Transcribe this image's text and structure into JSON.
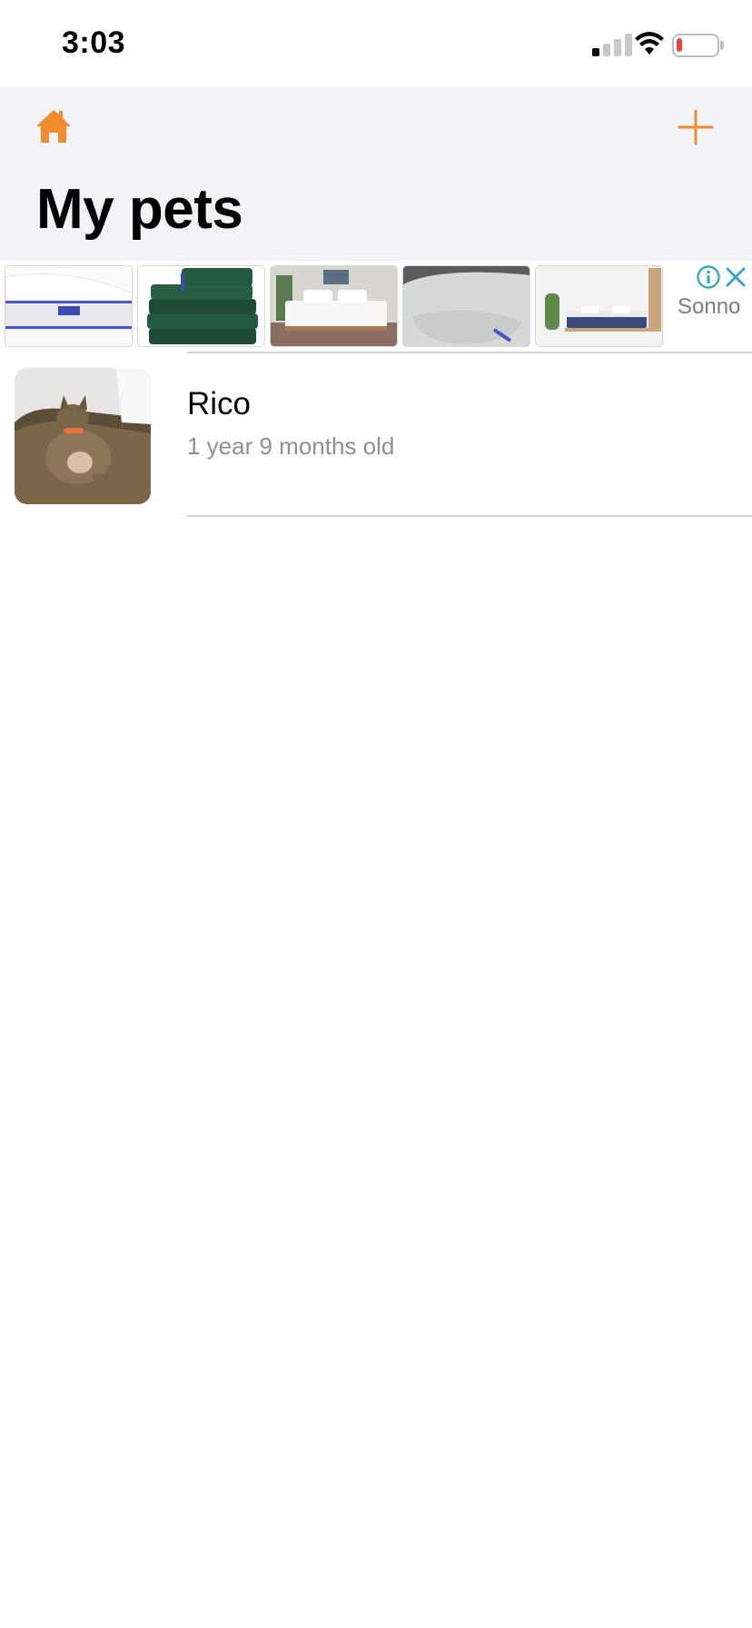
{
  "status_bar": {
    "time": "3:03",
    "signal_icon": "cellular-signal-icon",
    "wifi_icon": "wifi-icon",
    "battery_icon": "battery-low-icon",
    "battery_level": 0.15
  },
  "header": {
    "home_icon": "home-icon",
    "add_icon": "plus-icon",
    "title": "My pets",
    "accent_color": "#f28b30"
  },
  "ad": {
    "brand": "Sonno",
    "info_icon": "info-icon",
    "close_icon": "close-icon",
    "thumbnails": [
      {
        "subject": "white mattress"
      },
      {
        "subject": "green folded bed sheets"
      },
      {
        "subject": "bed in bedroom"
      },
      {
        "subject": "grey pillow"
      },
      {
        "subject": "bed with blue blanket"
      }
    ]
  },
  "pets": [
    {
      "name": "Rico",
      "age": "1 year 9 months old",
      "photo_subject": "tabby cat in litter box"
    }
  ],
  "colors": {
    "header_background": "#f2f2f7",
    "secondary_text": "#8e8e93",
    "divider": "#d1d1d6",
    "ad_icon_color": "#3aa7c9",
    "battery_red": "#e8443a"
  }
}
